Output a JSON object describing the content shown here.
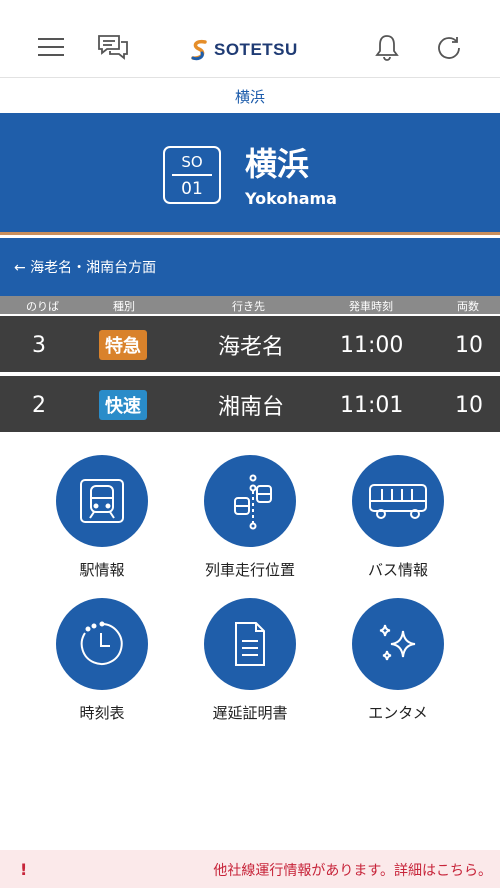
{
  "header": {
    "brand": "SOTETSU",
    "icons": [
      "hamburger-menu-icon",
      "chat-icon",
      "bell-icon",
      "refresh-icon"
    ]
  },
  "station_tab": "横浜",
  "station": {
    "line_code": "SO",
    "number": "01",
    "name_ja": "横浜",
    "name_en": "Yokohama"
  },
  "direction": "← 海老名・湘南台方面",
  "columns": {
    "platform": "のりば",
    "type": "種別",
    "destination": "行き先",
    "time": "発車時刻",
    "cars": "両数"
  },
  "departures": [
    {
      "platform": "3",
      "type": "特急",
      "type_color": "#d9822b",
      "destination": "海老名",
      "time": "11:00",
      "cars": "10"
    },
    {
      "platform": "2",
      "type": "快速",
      "type_color": "#2a8cc9",
      "destination": "湘南台",
      "time": "11:01",
      "cars": "10"
    }
  ],
  "menu": [
    {
      "label": "駅情報",
      "icon": "station-train-icon"
    },
    {
      "label": "列車走行位置",
      "icon": "train-position-icon"
    },
    {
      "label": "バス情報",
      "icon": "bus-icon"
    },
    {
      "label": "時刻表",
      "icon": "clock-icon"
    },
    {
      "label": "遅延証明書",
      "icon": "document-icon"
    },
    {
      "label": "エンタメ",
      "icon": "sparkle-icon"
    }
  ],
  "notice": {
    "text": "他社線運行情報があります。詳細はこちら。",
    "icon": "warning-icon"
  },
  "colors": {
    "brand_blue": "#1f5eaa",
    "row_dark": "#3e3e3e",
    "notice_bg": "#fbe9ea",
    "notice_text": "#c7243a"
  }
}
